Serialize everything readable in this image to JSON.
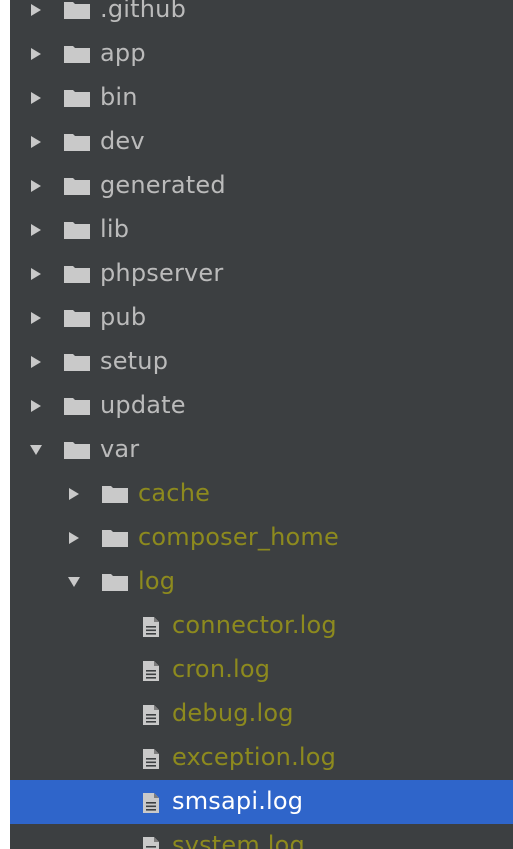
{
  "tree": {
    "items": [
      {
        "label": ".github",
        "depth": 0,
        "kind": "folder",
        "expanded": false,
        "status": "normal"
      },
      {
        "label": "app",
        "depth": 0,
        "kind": "folder",
        "expanded": false,
        "status": "normal"
      },
      {
        "label": "bin",
        "depth": 0,
        "kind": "folder",
        "expanded": false,
        "status": "normal"
      },
      {
        "label": "dev",
        "depth": 0,
        "kind": "folder",
        "expanded": false,
        "status": "normal"
      },
      {
        "label": "generated",
        "depth": 0,
        "kind": "folder",
        "expanded": false,
        "status": "normal"
      },
      {
        "label": "lib",
        "depth": 0,
        "kind": "folder",
        "expanded": false,
        "status": "normal"
      },
      {
        "label": "phpserver",
        "depth": 0,
        "kind": "folder",
        "expanded": false,
        "status": "normal"
      },
      {
        "label": "pub",
        "depth": 0,
        "kind": "folder",
        "expanded": false,
        "status": "normal"
      },
      {
        "label": "setup",
        "depth": 0,
        "kind": "folder",
        "expanded": false,
        "status": "normal"
      },
      {
        "label": "update",
        "depth": 0,
        "kind": "folder",
        "expanded": false,
        "status": "normal"
      },
      {
        "label": "var",
        "depth": 0,
        "kind": "folder",
        "expanded": true,
        "status": "normal"
      },
      {
        "label": "cache",
        "depth": 1,
        "kind": "folder",
        "expanded": false,
        "status": "ignored"
      },
      {
        "label": "composer_home",
        "depth": 1,
        "kind": "folder",
        "expanded": false,
        "status": "ignored"
      },
      {
        "label": "log",
        "depth": 1,
        "kind": "folder",
        "expanded": true,
        "status": "ignored"
      },
      {
        "label": "connector.log",
        "depth": 2,
        "kind": "file",
        "status": "ignored"
      },
      {
        "label": "cron.log",
        "depth": 2,
        "kind": "file",
        "status": "ignored"
      },
      {
        "label": "debug.log",
        "depth": 2,
        "kind": "file",
        "status": "ignored"
      },
      {
        "label": "exception.log",
        "depth": 2,
        "kind": "file",
        "status": "ignored"
      },
      {
        "label": "smsapi.log",
        "depth": 2,
        "kind": "file",
        "status": "selected",
        "selected": true
      },
      {
        "label": "system.log",
        "depth": 2,
        "kind": "file",
        "status": "ignored"
      }
    ]
  },
  "colors": {
    "panel_background": "#3c3f41",
    "normal_text": "#bbbbbb",
    "ignored_text": "#8d8a1e",
    "selection_background": "#2f65ca",
    "selected_text": "#ffffff",
    "icon": "#c9c9c9",
    "arrow": "#c9c9c9"
  },
  "icons": {
    "collapsed_arrow": "triangle-right-icon",
    "expanded_arrow": "triangle-down-icon",
    "folder": "folder-icon",
    "file": "text-file-icon"
  }
}
